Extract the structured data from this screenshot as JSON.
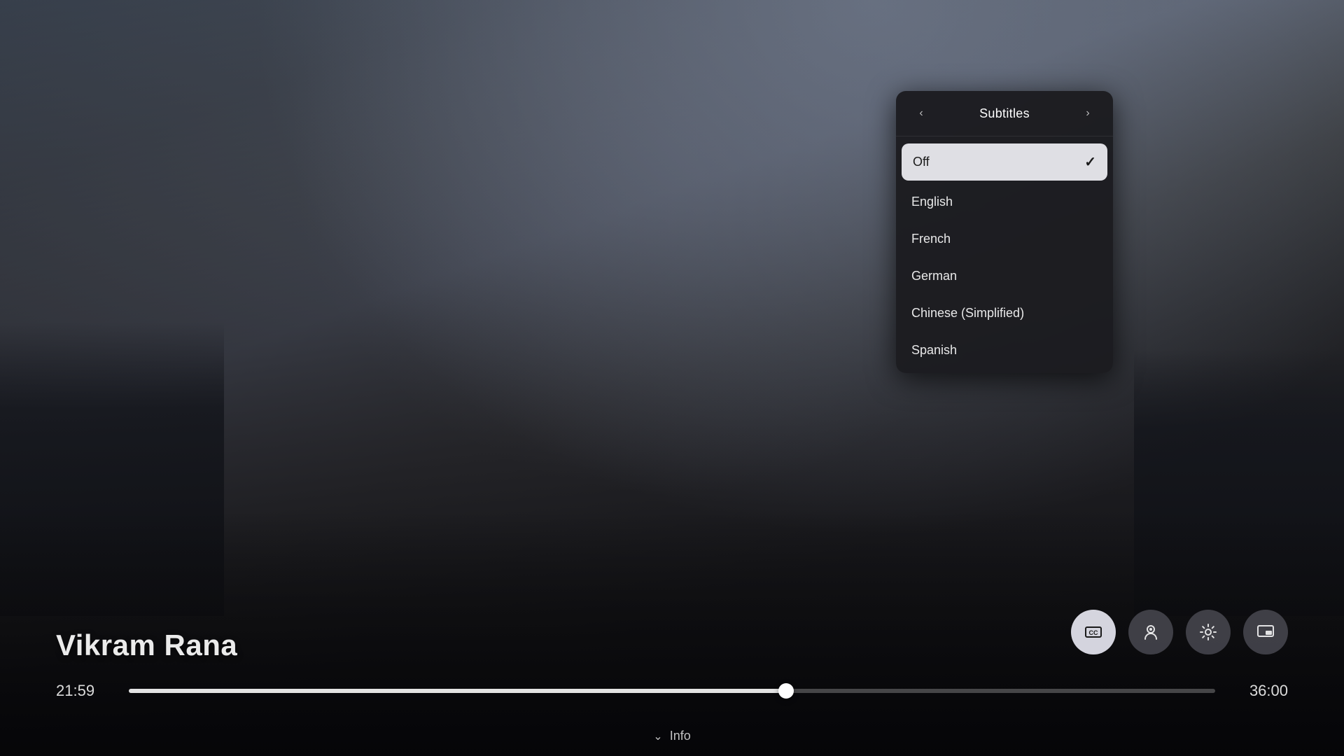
{
  "background": {
    "gradient_desc": "dark cinematic city background with hero silhouette"
  },
  "subtitles_panel": {
    "title": "Subtitles",
    "nav_left": "‹",
    "nav_right": "›",
    "options": [
      {
        "id": "off",
        "label": "Off",
        "selected": true
      },
      {
        "id": "english",
        "label": "English",
        "selected": false
      },
      {
        "id": "french",
        "label": "French",
        "selected": false
      },
      {
        "id": "german",
        "label": "German",
        "selected": false
      },
      {
        "id": "chinese_simplified",
        "label": "Chinese (Simplified)",
        "selected": false
      },
      {
        "id": "spanish",
        "label": "Spanish",
        "selected": false
      }
    ]
  },
  "player": {
    "movie_title": "Vikram Rana",
    "time_current": "21:59",
    "time_total": "36:00",
    "progress_percent": 60.5
  },
  "controls": {
    "subtitle_btn_label": "CC",
    "audio_btn_label": "♪",
    "settings_btn_label": "⚙",
    "pip_btn_label": "⧉"
  },
  "info_bar": {
    "chevron": "⌄",
    "label": "Info"
  }
}
